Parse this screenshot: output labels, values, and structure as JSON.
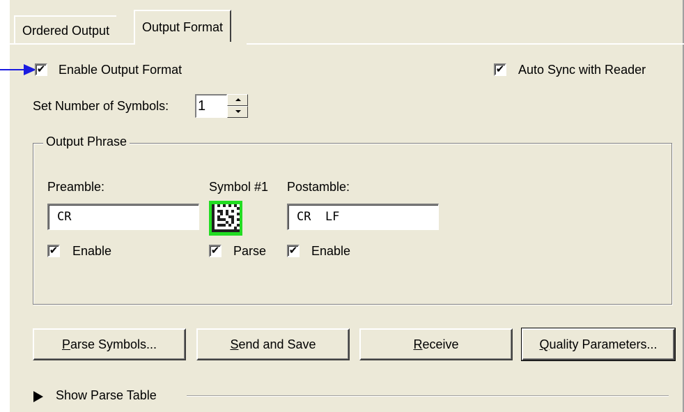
{
  "tabs": [
    {
      "label": "Ordered Output",
      "active": false
    },
    {
      "label": "Output Format",
      "active": true
    }
  ],
  "enable_output_format": {
    "label": "Enable Output Format",
    "checked": true
  },
  "auto_sync": {
    "label": "Auto Sync with Reader",
    "checked": true
  },
  "symbols": {
    "label": "Set Number of Symbols:",
    "value": "1"
  },
  "output_phrase": {
    "title": "Output Phrase",
    "preamble": {
      "label": "Preamble:",
      "value": "CR",
      "enable_label": "Enable",
      "enabled": true
    },
    "symbol": {
      "label": "Symbol #1",
      "parse_label": "Parse",
      "parse": true,
      "icon": "datamatrix-icon"
    },
    "postamble": {
      "label": "Postamble:",
      "value": "CR  LF",
      "enable_label": "Enable",
      "enabled": true
    }
  },
  "buttons": {
    "parse_symbols": {
      "mnemonic": "P",
      "rest": "arse Symbols..."
    },
    "send_save": {
      "mnemonic": "S",
      "rest": "end and Save"
    },
    "receive": {
      "mnemonic": "R",
      "rest": "eceive"
    },
    "quality": {
      "mnemonic": "Q",
      "rest": "uality Parameters..."
    }
  },
  "show_parse_table": {
    "label": "Show Parse Table"
  },
  "colors": {
    "panel_bg": "#ece9d8",
    "pointer_arrow": "#1b1be0",
    "symbol_highlight": "#22dd22"
  }
}
